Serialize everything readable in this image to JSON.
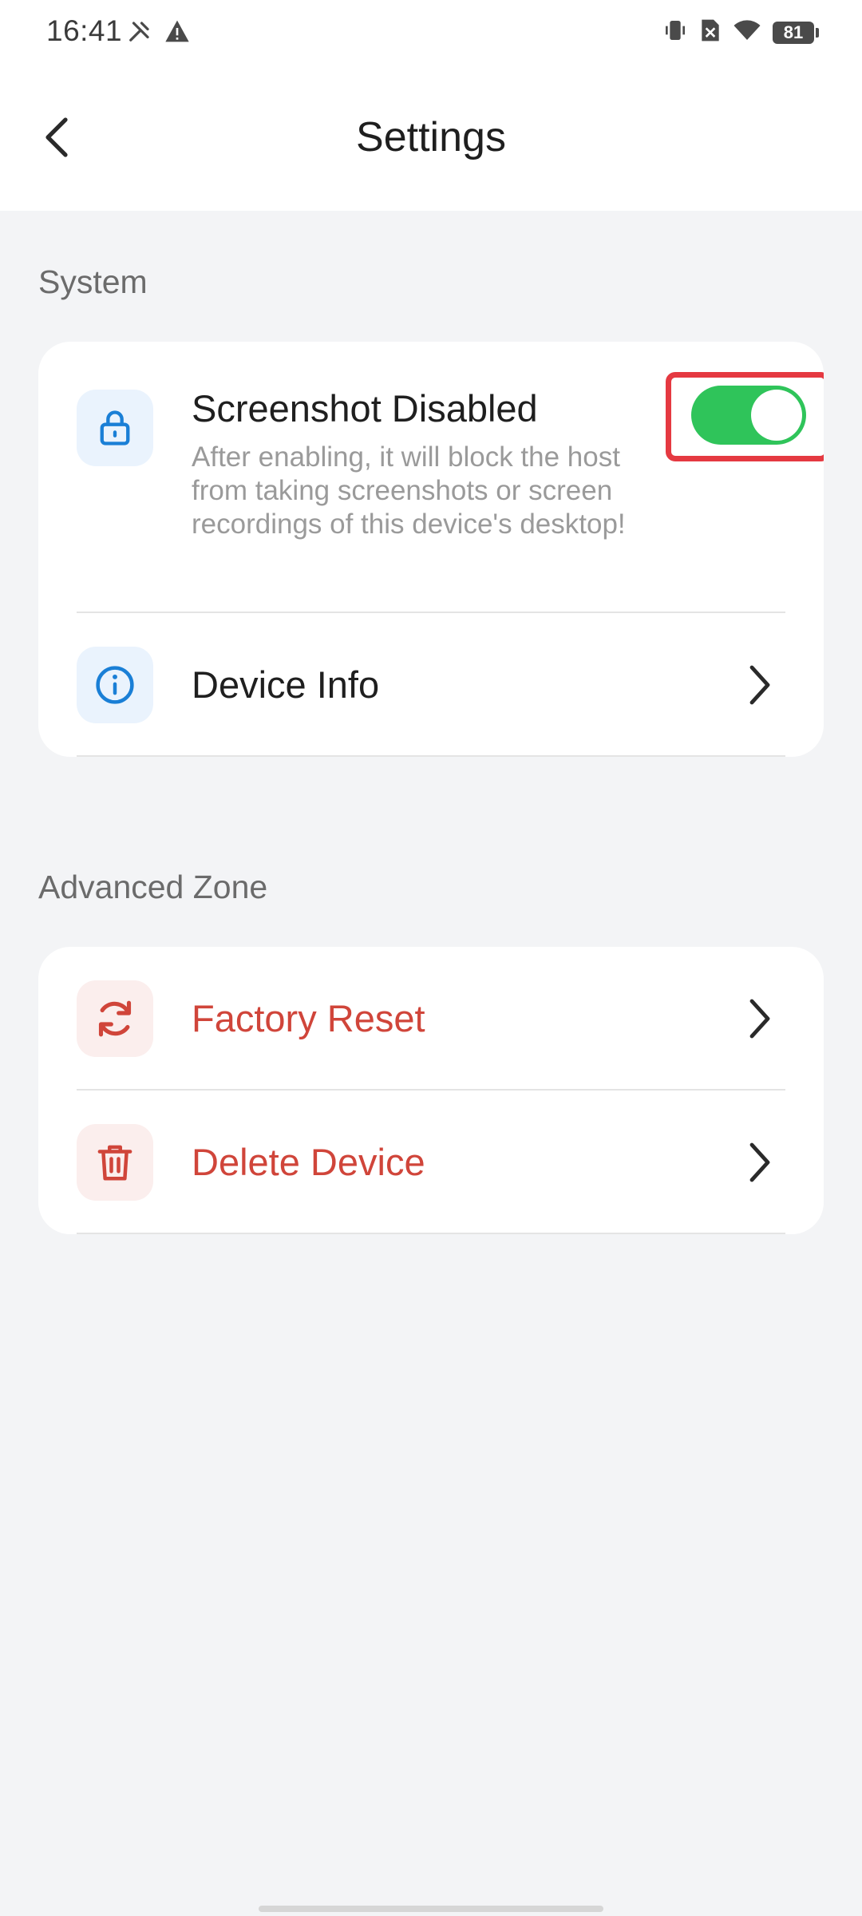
{
  "status_bar": {
    "time": "16:41",
    "battery": "81",
    "icons": [
      "tools-icon",
      "warning-icon",
      "vibrate-icon",
      "no-sim-icon",
      "wifi-icon",
      "battery-icon"
    ]
  },
  "header": {
    "title": "Settings",
    "back_icon": "chevron-left-icon"
  },
  "sections": {
    "system": {
      "title": "System",
      "screenshot": {
        "label": "Screenshot Disabled",
        "description": "After enabling, it will block the host from taking screenshots or screen recordings of this device's desktop!",
        "toggle_on": true,
        "icon": "lock-icon"
      },
      "device_info": {
        "label": "Device Info",
        "icon": "info-icon"
      }
    },
    "advanced": {
      "title": "Advanced Zone",
      "factory_reset": {
        "label": "Factory Reset",
        "icon": "refresh-icon"
      },
      "delete_device": {
        "label": "Delete Device",
        "icon": "trash-icon"
      }
    }
  },
  "colors": {
    "accent_blue": "#1a7fd6",
    "danger_red": "#d0453a",
    "toggle_green": "#2fc45a",
    "highlight_red": "#e53941",
    "background": "#f3f4f6"
  }
}
